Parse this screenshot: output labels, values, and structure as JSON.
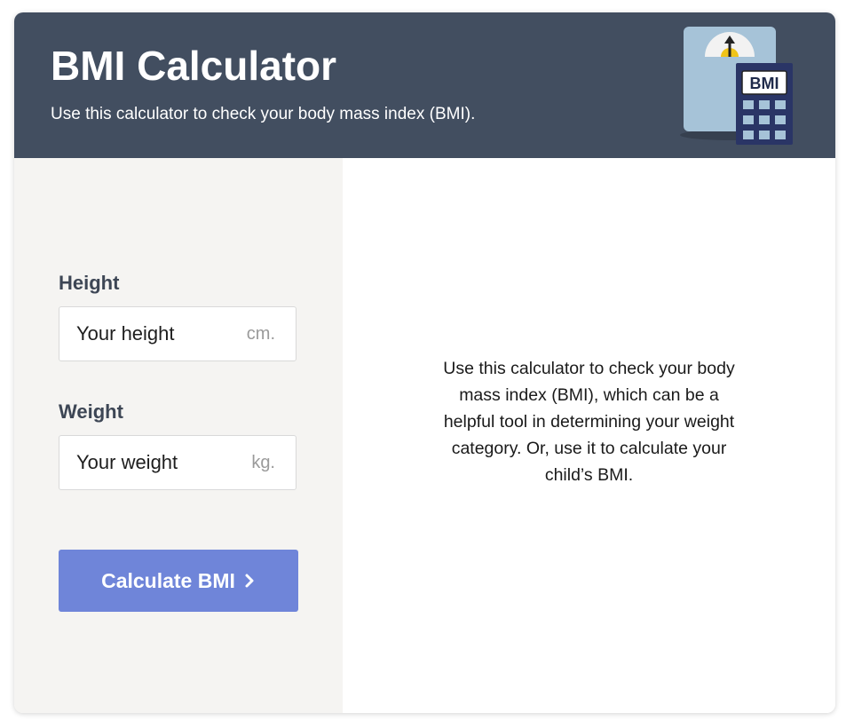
{
  "header": {
    "title": "BMI Calculator",
    "subtitle": "Use this calculator to check your body mass index (BMI).",
    "illustration_icon": "bmi-scale-calculator-illustration",
    "illustration_badge_text": "BMI",
    "background_color": "#424e60"
  },
  "form": {
    "height": {
      "label": "Height",
      "placeholder": "Your height",
      "value": "",
      "unit": "cm."
    },
    "weight": {
      "label": "Weight",
      "placeholder": "Your weight",
      "value": "",
      "unit": "kg."
    },
    "submit": {
      "label": "Calculate BMI",
      "icon": "chevron-right-icon",
      "color": "#6f85d9"
    }
  },
  "info": {
    "text": "Use this calculator to check your body mass index (BMI), which can be a helpful tool in determining your weight category. Or, use it to calculate your child’s BMI."
  }
}
